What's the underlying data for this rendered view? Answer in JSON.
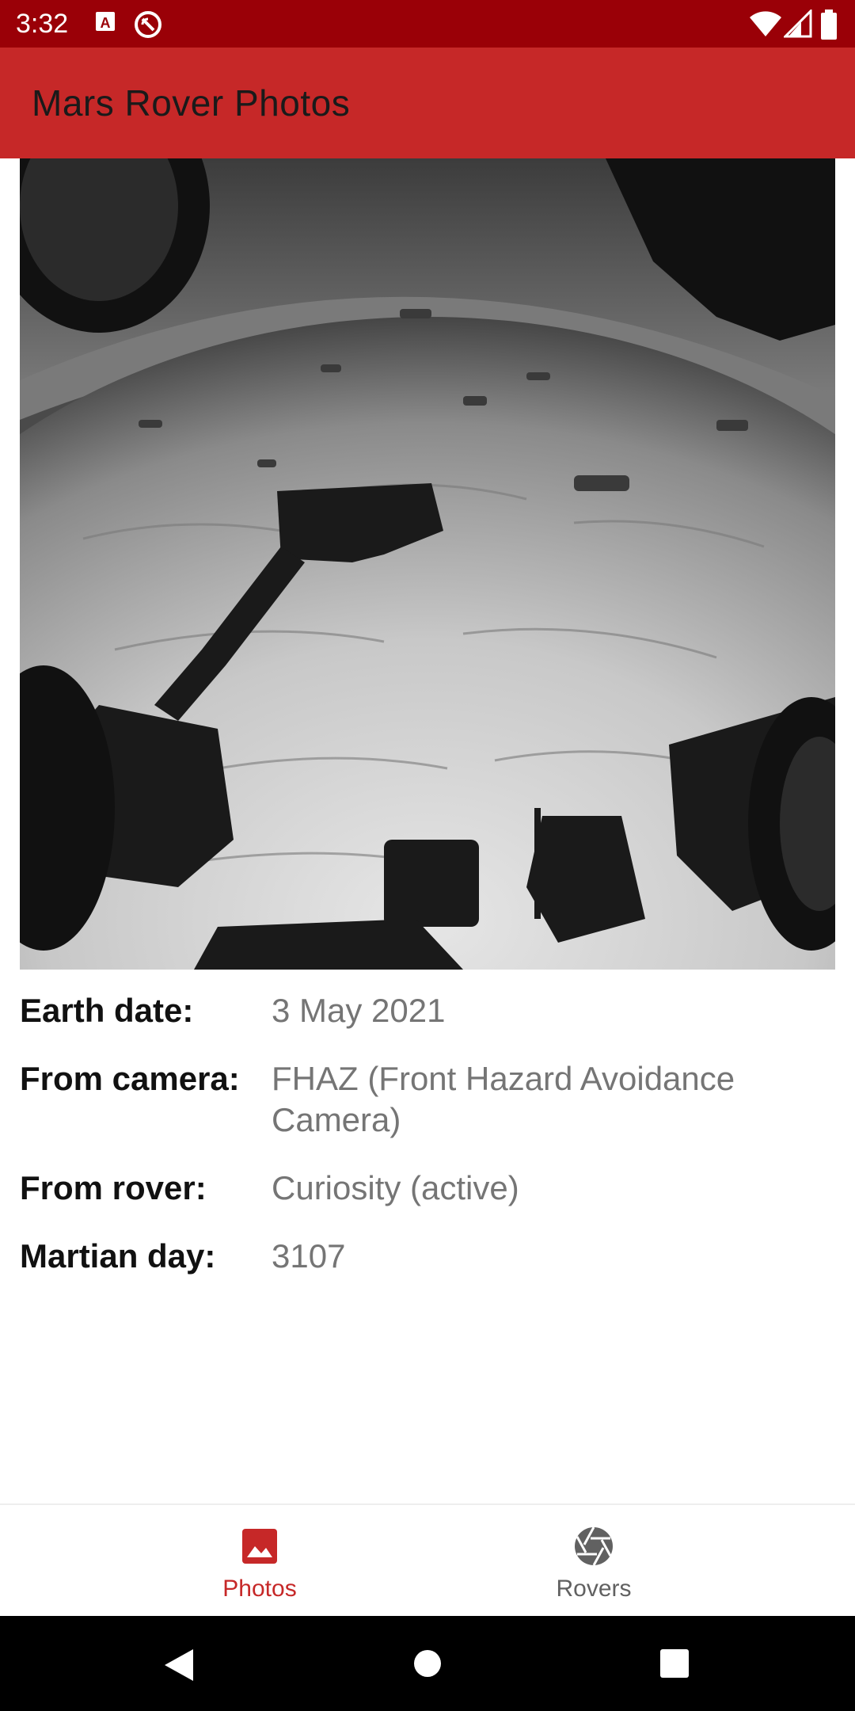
{
  "status_bar": {
    "time": "3:32",
    "left_icons": [
      "a-box-icon",
      "no-sync-icon"
    ],
    "right_icons": [
      "wifi-icon",
      "signal-icon",
      "battery-icon"
    ]
  },
  "app_bar": {
    "title": "Mars Rover Photos",
    "color": "#c62828"
  },
  "photo": {
    "description_icon": "mars-surface-photo"
  },
  "details": [
    {
      "label": "Earth date:",
      "value": "3 May 2021"
    },
    {
      "label": "From camera:",
      "value": "FHAZ (Front Hazard Avoidance Camera)"
    },
    {
      "label": "From rover:",
      "value": "Curiosity (active)"
    },
    {
      "label": "Martian day:",
      "value": "3107"
    }
  ],
  "bottom_nav": {
    "items": [
      {
        "label": "Photos",
        "icon": "image-icon",
        "active": true
      },
      {
        "label": "Rovers",
        "icon": "aperture-icon",
        "active": false
      }
    ],
    "active_color": "#c62828",
    "inactive_color": "#616161"
  },
  "system_nav": {
    "buttons": [
      "back-icon",
      "home-icon",
      "recents-icon"
    ]
  }
}
